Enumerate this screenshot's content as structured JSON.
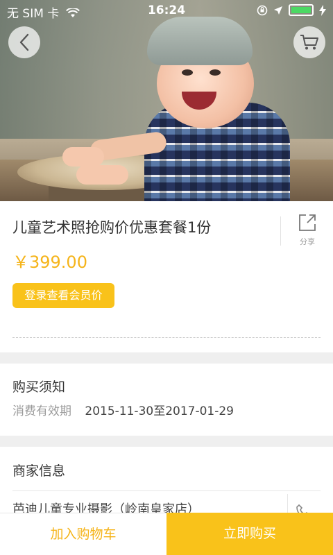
{
  "status_bar": {
    "carrier": "无 SIM 卡",
    "time": "16:24",
    "icons": [
      "wifi-icon",
      "orientation-lock-icon",
      "location-arrow-icon",
      "battery-icon",
      "charging-icon"
    ]
  },
  "hero": {
    "image_semantic": "product-photo",
    "back_icon": "chevron-left-icon",
    "cart_icon": "cart-icon"
  },
  "product": {
    "title": "儿童艺术照抢购价优惠套餐1份",
    "share_label": "分享",
    "price": "￥399.00",
    "member_price_button": "登录查看会员价"
  },
  "purchase_notice": {
    "title": "购买须知",
    "validity_label": "消费有效期",
    "validity_value": "2015-11-30至2017-01-29"
  },
  "merchant": {
    "title": "商家信息",
    "name": "芭迪儿童专业摄影（岭南皇家店）"
  },
  "bottom_bar": {
    "add_to_cart": "加入购物车",
    "buy_now": "立即购买"
  },
  "colors": {
    "accent": "#f9c21a",
    "price": "#f5b41a",
    "divider": "#efefef"
  }
}
